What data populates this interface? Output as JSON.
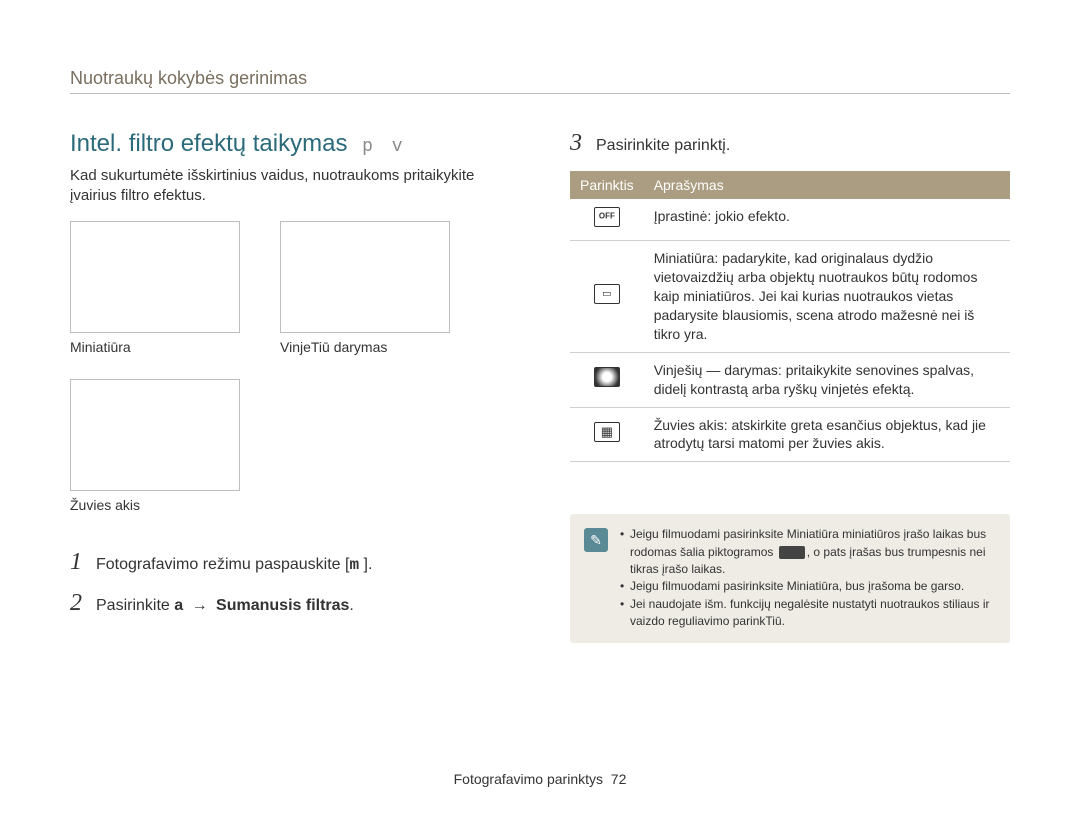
{
  "breadcrumb": "Nuotraukų kokybės gerinimas",
  "section_title_main": "Intel. ﬁltro efektų taikymas",
  "section_title_mono": "p v",
  "intro": "Kad sukurtumėte išskirtinius vaidus, nuotraukoms pritaikykite įvairius ﬁltro efektus.",
  "thumbs": [
    {
      "label": "Miniatiūra"
    },
    {
      "label": "VinjeTiū darymas"
    },
    {
      "label": "Žuvies akis"
    }
  ],
  "steps": [
    {
      "num": "1",
      "prefix": "Fotografavimo režimu paspauskite [",
      "mid_bold": "m",
      "suffix": "        ]."
    },
    {
      "num": "2",
      "prefix": "Pasirinkite ",
      "bold1": "a",
      "arrow": " → ",
      "bold2": "Sumanusis ﬁltras",
      "suffix": "."
    },
    {
      "num": "3",
      "prefix": "Pasirinkite parinktį.",
      "bold1": "",
      "arrow": "",
      "bold2": "",
      "suffix": ""
    }
  ],
  "table": {
    "head_option": "Parinktis",
    "head_desc": "Aprašymas",
    "rows": [
      {
        "icon": "off",
        "desc": "Įprastinė: jokio efekto."
      },
      {
        "icon": "mini",
        "desc": "Miniatiūra: padarykite, kad originalaus dydžio vietovaizdžių arba objektų nuotraukos būtų rodomos kaip miniatiūros. Jei kai kurias nuotraukos vietas padarysite blausiomis, scena atrodo mažesnė nei iš tikro yra."
      },
      {
        "icon": "vign",
        "desc": "Vinješių — darymas: pritaikykite senovines spalvas, didelį kontrastą arba ryškų vinjetės efektą."
      },
      {
        "icon": "fish",
        "desc": "Žuvies akis: atskirkite greta esančius objektus, kad jie atrodytų tarsi matomi per žuvies akis."
      }
    ]
  },
  "note": {
    "items": [
      "Jeigu ﬁlmuodami pasirinksite Miniatiūra miniatiūros įrašo laikas bus rodomas šalia piktogramos ▮, o pats įrašas bus trumpesnis nei tikras įrašo laikas.",
      "Jeigu ﬁlmuodami pasirinksite Miniatiūra, bus įrašoma be garso.",
      "Jei naudojate išm. funkcijų negalėsite nustatyti nuotraukos stiliaus ir vaizdo reguliavimo parinkTiū."
    ]
  },
  "footer_label": "Fotografavimo parinktys",
  "footer_page": "72"
}
